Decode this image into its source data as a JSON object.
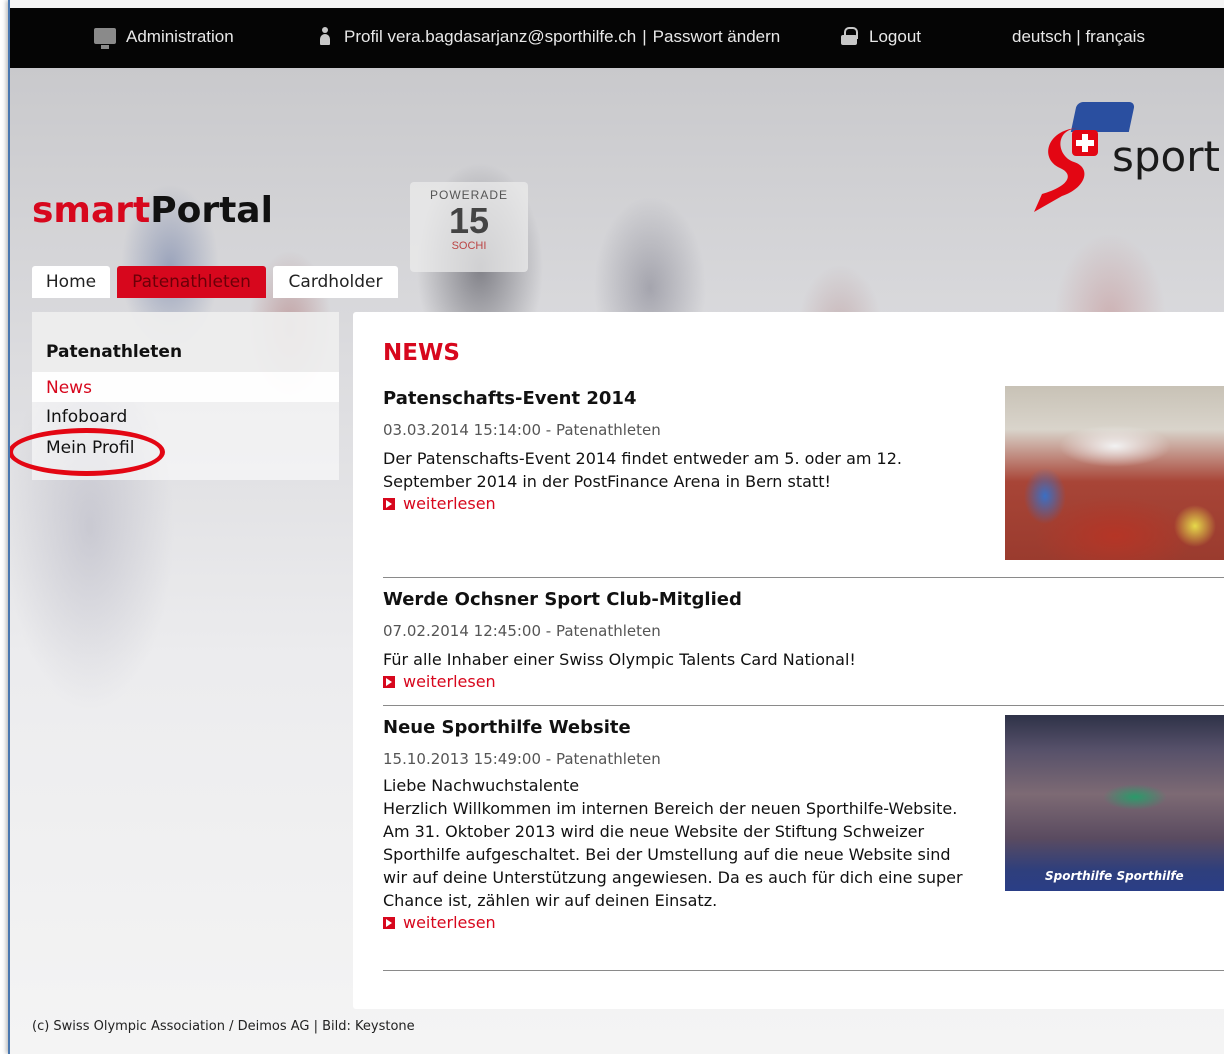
{
  "topbar": {
    "admin_label": "Administration",
    "profile_label": "Profil vera.bagdasarjanz@sporthilfe.ch",
    "separator": "|",
    "password_label": "Passwort ändern",
    "logout_label": "Logout",
    "lang_de": "deutsch",
    "lang_sep": "|",
    "lang_fr": "français"
  },
  "brand": {
    "logo_text": "sport",
    "title_smart": "smart",
    "title_portal": "Portal",
    "bib_sponsor": "POWERADE",
    "bib_number": "15",
    "bib_event": "SOCHI",
    "accent_color": "#d7071d"
  },
  "tabs": [
    {
      "label": "Home",
      "active": false
    },
    {
      "label": "Patenathleten",
      "active": true
    },
    {
      "label": "Cardholder",
      "active": false
    }
  ],
  "sidebar": {
    "heading": "Patenathleten",
    "items": [
      {
        "label": "News",
        "active": true
      },
      {
        "label": "Infoboard",
        "active": false
      },
      {
        "label": "Mein Profil",
        "active": false,
        "highlighted": true
      }
    ]
  },
  "main": {
    "heading": "NEWS",
    "readmore_label": "weiterlesen",
    "articles": [
      {
        "title": "Patenschafts-Event 2014",
        "meta": "03.03.2014 15:14:00 - Patenathleten",
        "body": "Der Patenschafts-Event 2014 findet entweder am 5. oder am 12. September 2014 in der PostFinance Arena in Bern statt!"
      },
      {
        "title": "Werde Ochsner Sport Club-Mitglied",
        "meta": "07.02.2014 12:45:00 - Patenathleten",
        "body": "Für alle Inhaber einer Swiss Olympic Talents Card National!"
      },
      {
        "title": "Neue Sporthilfe Website",
        "meta": "15.10.2013 15:49:00 - Patenathleten",
        "body_line1": "Liebe Nachwuchstalente",
        "body": "Herzlich Willkommen im internen Bereich der neuen Sporthilfe-Website. Am 31. Oktober 2013 wird die neue Website der Stiftung Schweizer Sporthilfe aufgeschaltet. Bei der Umstellung auf die neue Website sind wir auf deine Unterstützung angewiesen. Da es auch für dich eine super Chance ist, zählen wir auf deinen Einsatz."
      }
    ],
    "thumb2_banner": "Sporthilfe  Sporthilfe"
  },
  "footer": {
    "text": "(c) Swiss Olympic Association / Deimos AG | Bild: Keystone"
  }
}
